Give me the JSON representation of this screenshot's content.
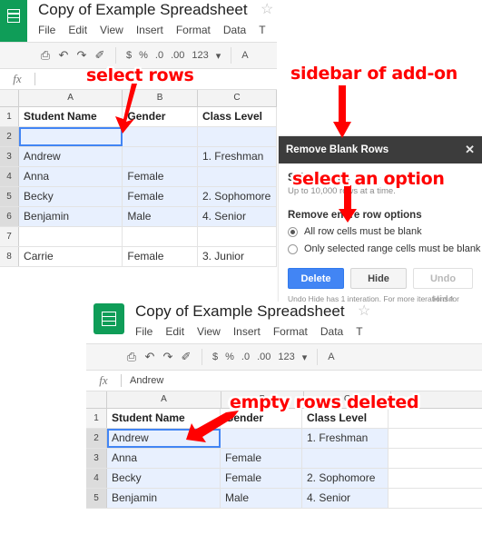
{
  "top_sheet": {
    "logo": "sheets-logo",
    "title": "Copy of Example Spreadsheet",
    "star": "☆",
    "menus": [
      "File",
      "Edit",
      "View",
      "Insert",
      "Format",
      "Data",
      "T"
    ],
    "toolbar": {
      "print": "⎙",
      "undo": "↶",
      "redo": "↷",
      "paint": "✐",
      "currency": "$",
      "percent": "%",
      "dec_decimal": ".0",
      "inc_decimal": ".00",
      "number_format": "123",
      "caret": "▾",
      "font": "A"
    },
    "formula_bar": {
      "fx": "fx",
      "value": ""
    },
    "columns": [
      "A",
      "B",
      "C"
    ],
    "rows": [
      {
        "num": "1",
        "header": true,
        "selected": false,
        "active": false,
        "cells": [
          "Student Name",
          "Gender",
          "Class Level"
        ]
      },
      {
        "num": "2",
        "header": false,
        "selected": true,
        "active": true,
        "cells": [
          "",
          "",
          ""
        ]
      },
      {
        "num": "3",
        "header": false,
        "selected": true,
        "active": false,
        "cells": [
          "Andrew",
          "",
          "1. Freshman"
        ]
      },
      {
        "num": "4",
        "header": false,
        "selected": true,
        "active": false,
        "cells": [
          "Anna",
          "Female",
          ""
        ]
      },
      {
        "num": "5",
        "header": false,
        "selected": true,
        "active": false,
        "cells": [
          "Becky",
          "Female",
          "2. Sophomore"
        ]
      },
      {
        "num": "6",
        "header": false,
        "selected": true,
        "active": false,
        "cells": [
          "Benjamin",
          "Male",
          "4. Senior"
        ]
      },
      {
        "num": "7",
        "header": false,
        "selected": false,
        "active": false,
        "cells": [
          "",
          "",
          ""
        ]
      },
      {
        "num": "8",
        "header": false,
        "selected": false,
        "active": false,
        "cells": [
          "Carrie",
          "Female",
          "3. Junior"
        ]
      }
    ]
  },
  "sidebar": {
    "header_title": "Remove Blank Rows",
    "close": "✕",
    "select_label": "Select range",
    "select_sub": "Up to 10,000 rows at a time.",
    "group_title": "Remove entire row options",
    "options": [
      {
        "label": "All row cells must be blank",
        "selected": true
      },
      {
        "label": "Only selected range cells must be blank",
        "selected": false
      }
    ],
    "buttons": [
      {
        "label": "Delete",
        "style": "primary"
      },
      {
        "label": "Hide",
        "style": "default"
      },
      {
        "label": "Undo Hide",
        "style": "disabled"
      }
    ],
    "footnote_line1": "Undo Hide has 1 interation. For more iterations for",
    "footnote_line2": "Hide use \"File\" revision history."
  },
  "bottom_sheet": {
    "logo": "sheets-logo",
    "title": "Copy of Example Spreadsheet",
    "star": "☆",
    "menus": [
      "File",
      "Edit",
      "View",
      "Insert",
      "Format",
      "Data",
      "T"
    ],
    "toolbar": {
      "print": "⎙",
      "undo": "↶",
      "redo": "↷",
      "paint": "✐",
      "currency": "$",
      "percent": "%",
      "dec_decimal": ".0",
      "inc_decimal": ".00",
      "number_format": "123",
      "caret": "▾",
      "font": "A"
    },
    "formula_bar": {
      "fx": "fx",
      "value": "Andrew"
    },
    "columns": [
      "A",
      "B",
      "C"
    ],
    "rows": [
      {
        "num": "1",
        "header": true,
        "selected": false,
        "active": false,
        "cells": [
          "Student Name",
          "Gender",
          "Class Level"
        ]
      },
      {
        "num": "2",
        "header": false,
        "selected": true,
        "active": true,
        "cells": [
          "Andrew",
          "",
          "1. Freshman"
        ]
      },
      {
        "num": "3",
        "header": false,
        "selected": true,
        "active": false,
        "cells": [
          "Anna",
          "Female",
          ""
        ]
      },
      {
        "num": "4",
        "header": false,
        "selected": true,
        "active": false,
        "cells": [
          "Becky",
          "Female",
          "2. Sophomore"
        ]
      },
      {
        "num": "5",
        "header": false,
        "selected": true,
        "active": false,
        "cells": [
          "Benjamin",
          "Male",
          "4. Senior"
        ]
      }
    ]
  },
  "annotations": [
    {
      "id": "select-rows",
      "text": "select rows"
    },
    {
      "id": "sidebar-of-addon",
      "text": "sidebar of add-on"
    },
    {
      "id": "select-an-option",
      "text": "select an option"
    },
    {
      "id": "empty-rows-deleted",
      "text": "empty rows deleted"
    }
  ],
  "colors": {
    "sheets_green": "#0f9d58",
    "annotation_red": "#ff0000",
    "primary_blue": "#4285f4",
    "selection_blue": "#e8f0fe",
    "sidebar_header": "#3c3c3c"
  }
}
